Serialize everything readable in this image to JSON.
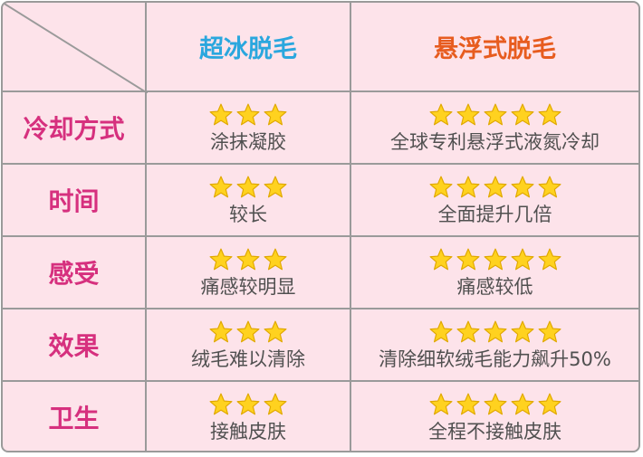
{
  "header": {
    "col1": "超冰脱毛",
    "col2": "悬浮式脱毛"
  },
  "colors": {
    "background": "#fde3ea",
    "border": "#9a9a9a",
    "col1_heading": "#2aa7de",
    "col2_heading": "#e75c1f",
    "row_label": "#d6307e",
    "star_fill": "#ffd21f",
    "star_stroke": "#e0a800"
  },
  "rows": [
    {
      "label": "冷却方式",
      "col1": {
        "stars": 3,
        "text": "涂抹凝胶"
      },
      "col2": {
        "stars": 5,
        "text": "全球专利悬浮式液氮冷却"
      }
    },
    {
      "label": "时间",
      "col1": {
        "stars": 3,
        "text": "较长"
      },
      "col2": {
        "stars": 5,
        "text": "全面提升几倍"
      }
    },
    {
      "label": "感受",
      "col1": {
        "stars": 3,
        "text": "痛感较明显"
      },
      "col2": {
        "stars": 5,
        "text": "痛感较低"
      }
    },
    {
      "label": "效果",
      "col1": {
        "stars": 3,
        "text": "绒毛难以清除"
      },
      "col2": {
        "stars": 5,
        "text": "清除细软绒毛能力飙升50%"
      }
    },
    {
      "label": "卫生",
      "col1": {
        "stars": 3,
        "text": "接触皮肤"
      },
      "col2": {
        "stars": 5,
        "text": "全程不接触皮肤"
      }
    }
  ]
}
